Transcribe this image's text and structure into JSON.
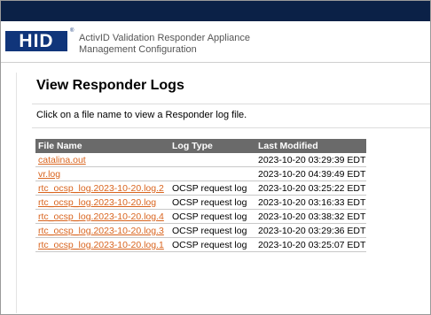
{
  "header": {
    "logo_text": "HID",
    "logo_mark": "®",
    "app_title_line1": "ActivID Validation Responder Appliance",
    "app_title_line2": "Management Configuration"
  },
  "page": {
    "title": "View Responder Logs",
    "instructions": "Click on a file name to view a Responder log file."
  },
  "table": {
    "headers": {
      "file_name": "File Name",
      "log_type": "Log Type",
      "last_modified": "Last Modified"
    },
    "rows": [
      {
        "file_name": "catalina.out",
        "log_type": "",
        "last_modified": "2023-10-20 03:29:39 EDT"
      },
      {
        "file_name": "vr.log",
        "log_type": "",
        "last_modified": "2023-10-20 04:39:49 EDT"
      },
      {
        "file_name": "rtc_ocsp_log.2023-10-20.log.2",
        "log_type": "OCSP request log",
        "last_modified": "2023-10-20 03:25:22 EDT"
      },
      {
        "file_name": "rtc_ocsp_log.2023-10-20.log",
        "log_type": "OCSP request log",
        "last_modified": "2023-10-20 03:16:33 EDT"
      },
      {
        "file_name": "rtc_ocsp_log.2023-10-20.log.4",
        "log_type": "OCSP request log",
        "last_modified": "2023-10-20 03:38:32 EDT"
      },
      {
        "file_name": "rtc_ocsp_log.2023-10-20.log.3",
        "log_type": "OCSP request log",
        "last_modified": "2023-10-20 03:29:36 EDT"
      },
      {
        "file_name": "rtc_ocsp_log.2023-10-20.log.1",
        "log_type": "OCSP request log",
        "last_modified": "2023-10-20 03:25:07 EDT"
      }
    ]
  },
  "colors": {
    "topbar": "#0b2147",
    "logo": "#10357a",
    "link": "#d9641e",
    "table_header": "#6a6a6a"
  }
}
